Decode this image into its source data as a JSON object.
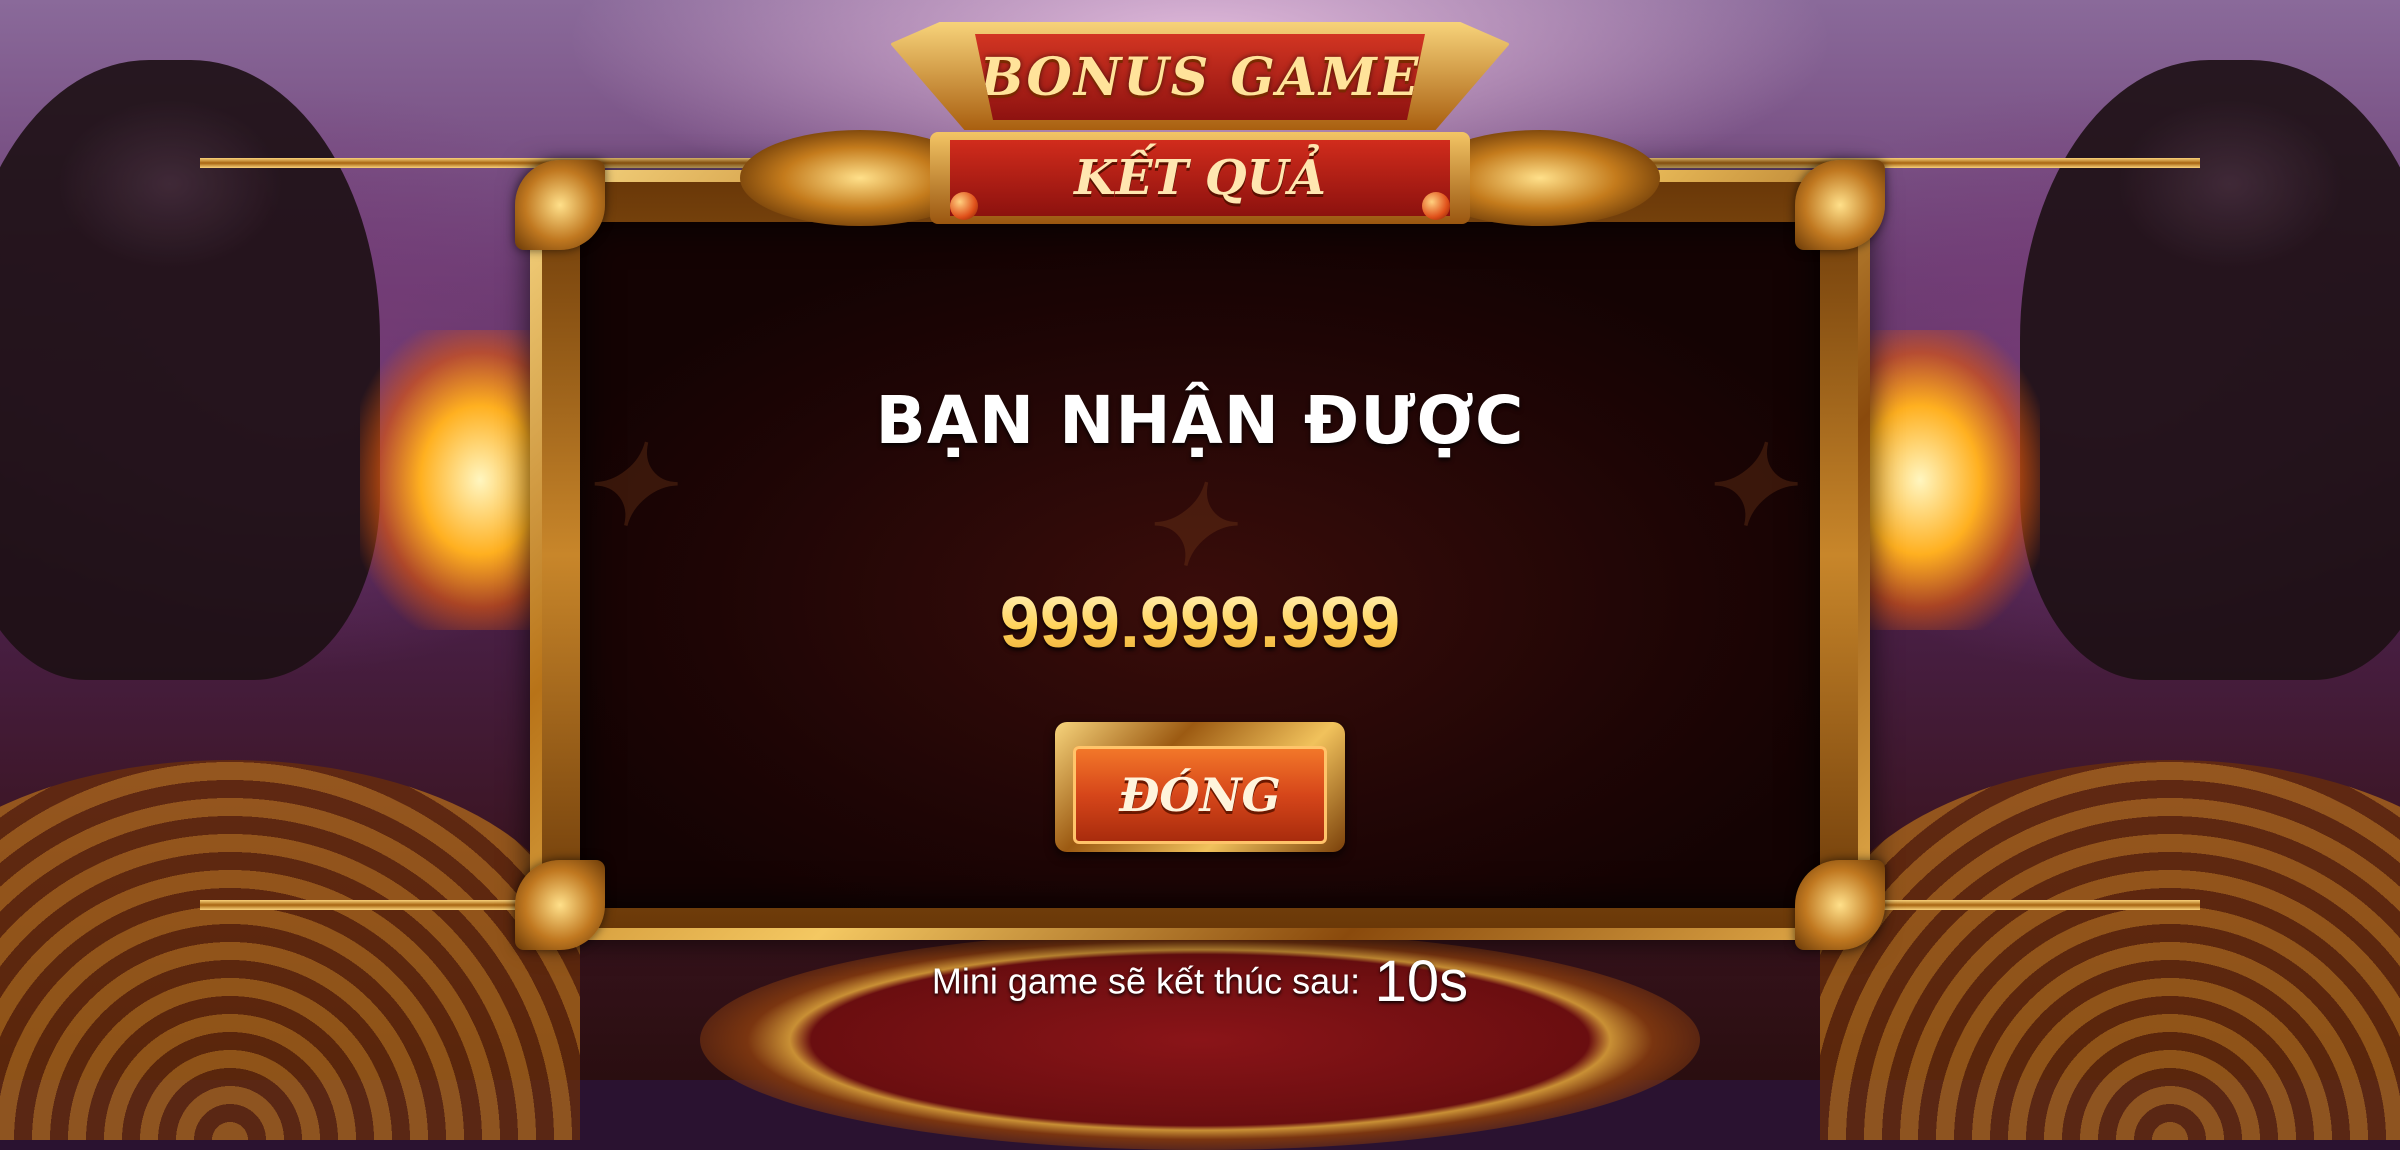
{
  "header": {
    "game_title": "BONUS GAME",
    "section_title": "KẾT QUẢ"
  },
  "result": {
    "heading": "BẠN NHẬN ĐƯỢC",
    "amount": "999.999.999"
  },
  "actions": {
    "close_label": "ĐÓNG"
  },
  "footer": {
    "countdown_label": "Mini game sẽ kết thúc sau:",
    "countdown_value": "10s"
  },
  "colors": {
    "gold": "#f4c862",
    "ribbon_red": "#c12a1a",
    "amount_gold": "#ffd35a",
    "button_orange": "#d6461a",
    "panel_dark": "#1e0505"
  }
}
